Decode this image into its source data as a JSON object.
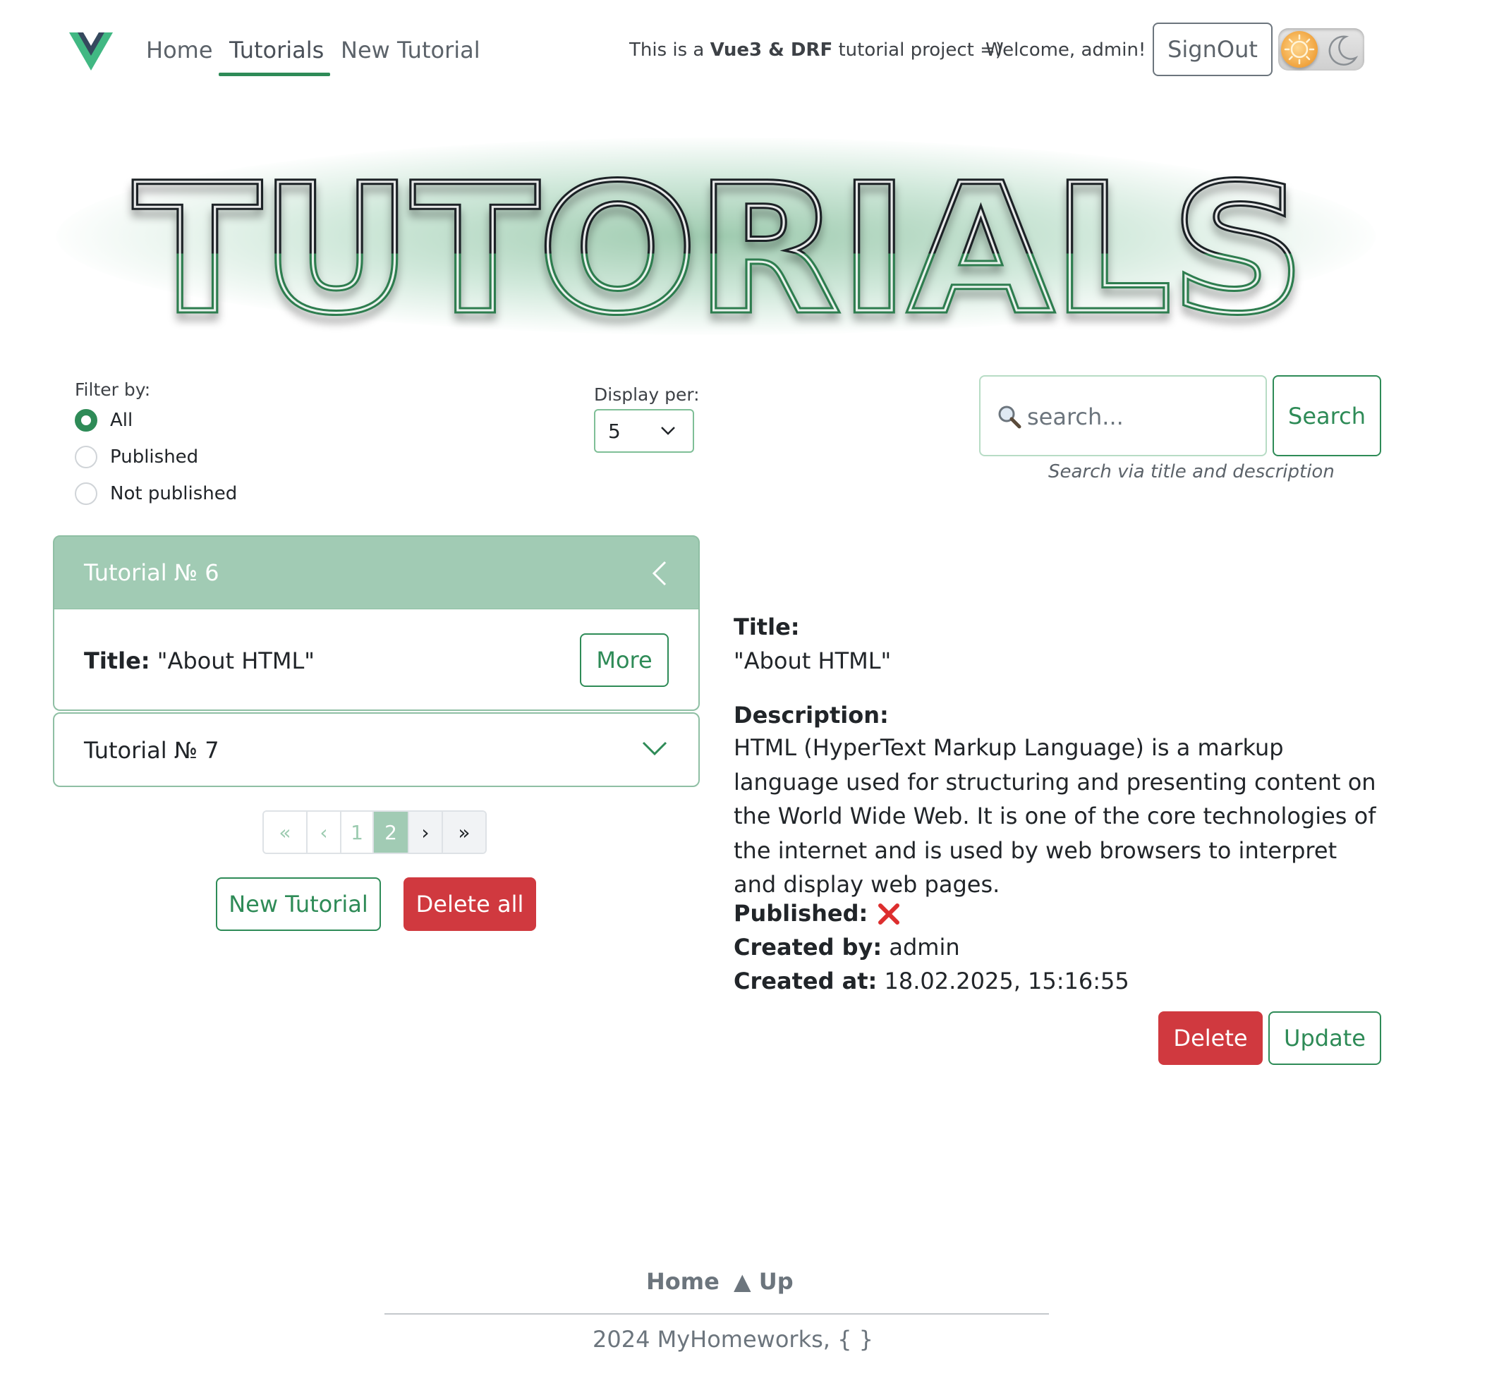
{
  "navbar": {
    "links": [
      "Home",
      "Tutorials",
      "New Tutorial"
    ],
    "active_link": "Tutorials",
    "tagline_prefix": "This is a ",
    "tagline_bold": "Vue3 & DRF",
    "tagline_suffix": " tutorial project =)",
    "welcome": "Welcome, admin!",
    "signout_label": "SignOut",
    "theme": "light"
  },
  "hero": {
    "text": "TUTORIALS"
  },
  "filters": {
    "label": "Filter by:",
    "options": [
      "All",
      "Published",
      "Not published"
    ],
    "selected": "All",
    "display_label": "Display per:",
    "display_value": "5"
  },
  "search": {
    "placeholder": "search...",
    "button_label": "Search",
    "hint": "Search via title and description"
  },
  "accordion": {
    "open_item": {
      "header": "Tutorial № 6",
      "title_label": "Title:",
      "title_value": "\"About HTML\"",
      "more_label": "More"
    },
    "closed_item": {
      "header": "Tutorial № 7"
    }
  },
  "pagination": {
    "first": "«",
    "prev": "‹",
    "pages": [
      "1",
      "2"
    ],
    "current_page": 2,
    "next": "›",
    "last": "»"
  },
  "actions": {
    "new_tutorial": "New Tutorial",
    "delete_all": "Delete all"
  },
  "details": {
    "title_label": "Title:",
    "title_value": "\"About HTML\"",
    "description_label": "Description:",
    "description": "HTML (HyperText Markup Language) is a markup language used for structuring and presenting content on the World Wide Web. It is one of the core technologies of the internet and is used by web browsers to interpret and display web pages.",
    "published_label": "Published:",
    "published": false,
    "created_by_label": "Created by:",
    "created_by": "admin",
    "created_at_label": "Created at:",
    "created_at": "18.02.2025, 15:16:55",
    "delete_label": "Delete",
    "update_label": "Update"
  },
  "footer": {
    "home": "Home",
    "up": "▲ Up",
    "copyright": "2024 MyHomeworks, { }"
  },
  "colors": {
    "accent": "#2e8b57",
    "accent_light": "#a1cbb4",
    "danger": "#d0393f"
  }
}
